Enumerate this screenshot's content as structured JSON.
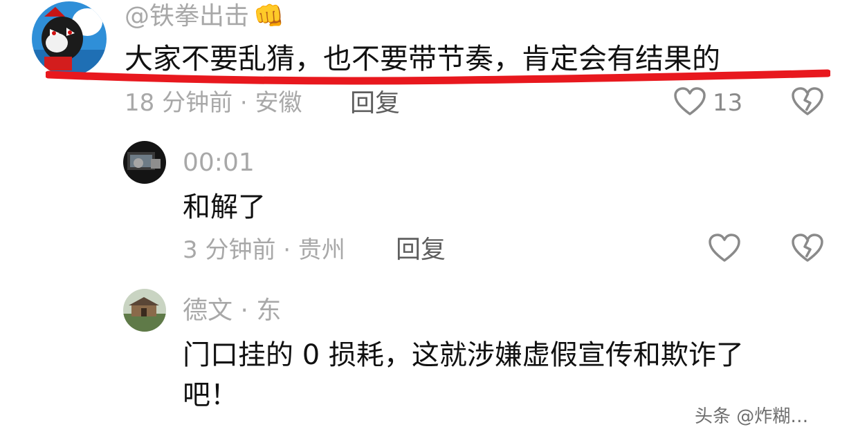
{
  "comments": [
    {
      "username": "@铁拳出击",
      "emoji": "👊",
      "text": "大家不要乱猜，也不要带节奏，肯定会有结果的",
      "meta": "18 分钟前 · 安徽",
      "reply_label": "回复",
      "like_count": "13"
    },
    {
      "username": "00:01",
      "text": "和解了",
      "meta": "3 分钟前 · 贵州",
      "reply_label": "回复"
    },
    {
      "username": "德文 · 东",
      "text_line1": "门口挂的 0 损耗，这就涉嫌虚假宣传和欺诈了",
      "text_line2": "吧！"
    }
  ],
  "watermark": "头条 @炸糊…",
  "colors": {
    "highlight_underline": "#e8181e",
    "secondary_text": "#a8a8a8",
    "reply_text": "#5e5e5e",
    "icon_stroke": "#8a8a8a"
  },
  "icons": [
    "heart-outline-icon",
    "broken-heart-icon"
  ]
}
